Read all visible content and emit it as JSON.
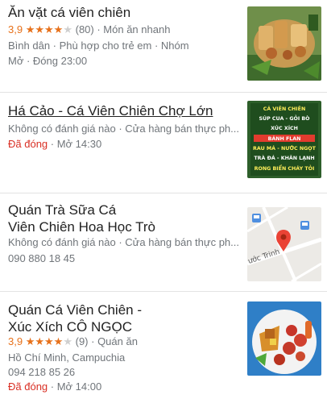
{
  "results": [
    {
      "name": "Ăn vặt cá viên chiên",
      "rating": "3,9",
      "stars_filled": "★★★★",
      "stars_empty": "★",
      "reviews": "(80)",
      "separator": " · ",
      "category": "Món ăn nhanh",
      "details": "Bình dân · Phù hợp cho trẻ em · Nhóm",
      "hours": "Mở · Đóng 23:00",
      "image": "thumbnail-food-photo"
    },
    {
      "name": "Há Cảo - Cá Viên Chiên Chợ Lớn",
      "info": "Không có đánh giá nào · Cửa hàng bán thực ph...",
      "status": "Đã đóng",
      "hours": " · Mở 14:30",
      "image": "thumbnail-menu-board",
      "menu_lines": [
        "CÁ VIÊN CHIÊN",
        "SÚP CUA - GỎI BÒ",
        "XÚC XÍCH",
        "BÁNH FLAN",
        "RAU MÁ - NƯỚC NGỌT",
        "TRÀ ĐÁ - KHĂN LẠNH",
        "RONG BIỂN CHÁY TỎI"
      ]
    },
    {
      "name_line1": "Quán Trà Sữa Cá",
      "name_line2": "Viên Chiên Hoa Học Trò",
      "info": "Không có đánh giá nào · Cửa hàng bán thực ph...",
      "phone": "090 880 18 45",
      "image": "thumbnail-map",
      "map_street": "ước Trinh"
    },
    {
      "name_line1": "Quán Cá Viên Chiên -",
      "name_line2": "Xúc Xích CÔ NGỌC",
      "rating": "3,9",
      "stars_filled": "★★★★",
      "stars_empty": "★",
      "reviews": "(9)",
      "separator": " · ",
      "category": "Quán ăn",
      "address": "Hồ Chí Minh, Campuchia",
      "phone": "094 218 85 26",
      "status": "Đã đóng",
      "hours": " · Mở 14:00",
      "image": "thumbnail-food-plate"
    }
  ],
  "colors": {
    "rating": "#e7711b",
    "closed": "#d93025",
    "secondary_text": "#70757a",
    "map_pin": "#ea4335",
    "divider": "#e3e3e3"
  }
}
